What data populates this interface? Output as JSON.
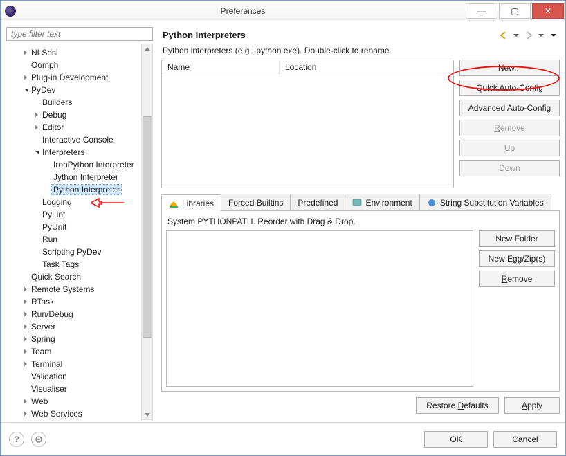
{
  "window": {
    "title": "Preferences"
  },
  "filter_placeholder": "type filter text",
  "tree": [
    {
      "label": "NLSdsl",
      "depth": 1,
      "twisty": "closed"
    },
    {
      "label": "Oomph",
      "depth": 1,
      "twisty": "none"
    },
    {
      "label": "Plug-in Development",
      "depth": 1,
      "twisty": "closed"
    },
    {
      "label": "PyDev",
      "depth": 1,
      "twisty": "open"
    },
    {
      "label": "Builders",
      "depth": 2,
      "twisty": "none"
    },
    {
      "label": "Debug",
      "depth": 2,
      "twisty": "closed"
    },
    {
      "label": "Editor",
      "depth": 2,
      "twisty": "closed"
    },
    {
      "label": "Interactive Console",
      "depth": 2,
      "twisty": "none"
    },
    {
      "label": "Interpreters",
      "depth": 2,
      "twisty": "open"
    },
    {
      "label": "IronPython Interpreter",
      "depth": 3,
      "twisty": "none"
    },
    {
      "label": "Jython Interpreter",
      "depth": 3,
      "twisty": "none"
    },
    {
      "label": "Python Interpreter",
      "depth": 3,
      "twisty": "none",
      "selected": true
    },
    {
      "label": "Logging",
      "depth": 2,
      "twisty": "none"
    },
    {
      "label": "PyLint",
      "depth": 2,
      "twisty": "none"
    },
    {
      "label": "PyUnit",
      "depth": 2,
      "twisty": "none"
    },
    {
      "label": "Run",
      "depth": 2,
      "twisty": "none"
    },
    {
      "label": "Scripting PyDev",
      "depth": 2,
      "twisty": "none"
    },
    {
      "label": "Task Tags",
      "depth": 2,
      "twisty": "none"
    },
    {
      "label": "Quick Search",
      "depth": 1,
      "twisty": "none"
    },
    {
      "label": "Remote Systems",
      "depth": 1,
      "twisty": "closed"
    },
    {
      "label": "RTask",
      "depth": 1,
      "twisty": "closed"
    },
    {
      "label": "Run/Debug",
      "depth": 1,
      "twisty": "closed"
    },
    {
      "label": "Server",
      "depth": 1,
      "twisty": "closed"
    },
    {
      "label": "Spring",
      "depth": 1,
      "twisty": "closed"
    },
    {
      "label": "Team",
      "depth": 1,
      "twisty": "closed"
    },
    {
      "label": "Terminal",
      "depth": 1,
      "twisty": "closed"
    },
    {
      "label": "Validation",
      "depth": 1,
      "twisty": "none"
    },
    {
      "label": "Visualiser",
      "depth": 1,
      "twisty": "none"
    },
    {
      "label": "Web",
      "depth": 1,
      "twisty": "closed"
    },
    {
      "label": "Web Services",
      "depth": 1,
      "twisty": "closed"
    }
  ],
  "right": {
    "heading": "Python Interpreters",
    "description": "Python interpreters (e.g.: python.exe).   Double-click to rename.",
    "columns": {
      "name": "Name",
      "location": "Location"
    },
    "buttons": {
      "new": "New...",
      "quick": "Quick Auto-Config",
      "advanced": "Advanced Auto-Config",
      "remove": "Remove",
      "up": "Up",
      "down": "Down"
    },
    "tabs": {
      "libraries": "Libraries",
      "forced": "Forced Builtins",
      "predefined": "Predefined",
      "environment": "Environment",
      "stringsub": "String Substitution Variables"
    },
    "pythonpath_hint": "System PYTHONPATH.   Reorder with Drag & Drop.",
    "pp_buttons": {
      "newfolder": "New Folder",
      "newegg": "New Egg/Zip(s)",
      "remove": "Remove"
    },
    "restore": "Restore Defaults",
    "apply": "Apply"
  },
  "footer": {
    "ok": "OK",
    "cancel": "Cancel"
  }
}
